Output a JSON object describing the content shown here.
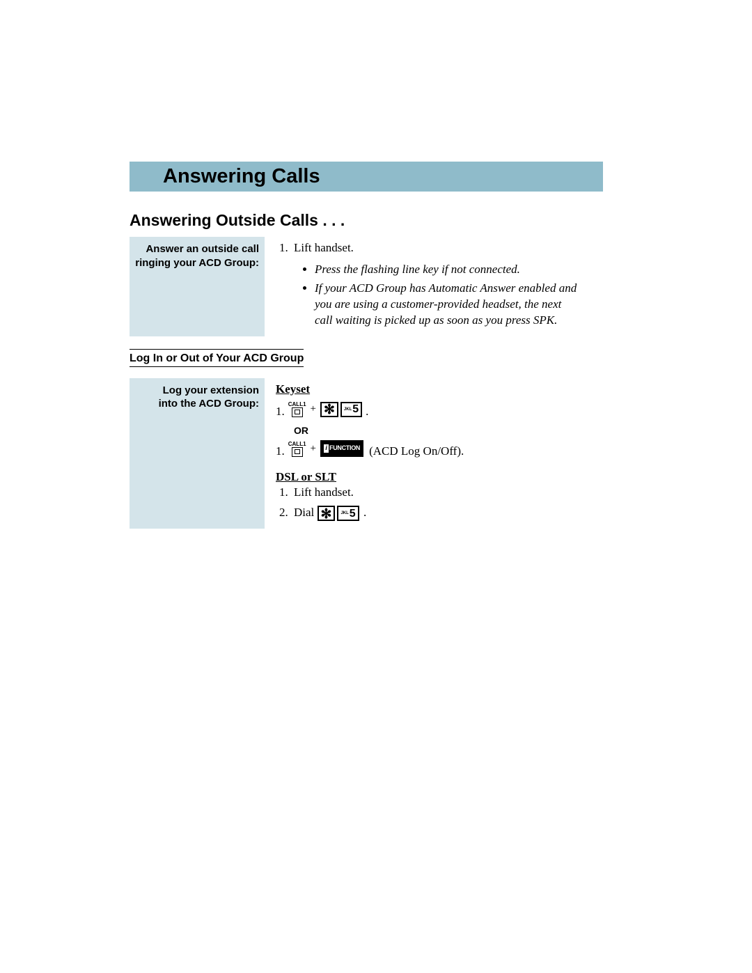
{
  "title": "Answering Calls",
  "section1": {
    "heading": "Answering Outside Calls . . .",
    "side_label_l1": "Answer an outside call",
    "side_label_l2": "ringing your ACD Group:",
    "step1": "Lift handset.",
    "bullet1": "Press the flashing line key if not connected.",
    "bullet2": "If your ACD Group has Automatic Answer enabled and you are using a customer-provided headset, the next call waiting is picked up as soon as you press SPK."
  },
  "section2": {
    "heading": "Log In or Out of Your ACD Group",
    "side_label_l1": "Log your extension",
    "side_label_l2": "into the ACD Group:",
    "keyset_label": "Keyset",
    "call1_label": "CALL1",
    "or_label": "OR",
    "function_label": "FUNCTION",
    "acd_trail": " (ACD Log On/Off).",
    "dsl_label": "DSL or SLT",
    "dsl_step1": "Lift handset.",
    "dsl_step2_prefix": "Dial ",
    "jkl": "JKL",
    "five": "5"
  }
}
